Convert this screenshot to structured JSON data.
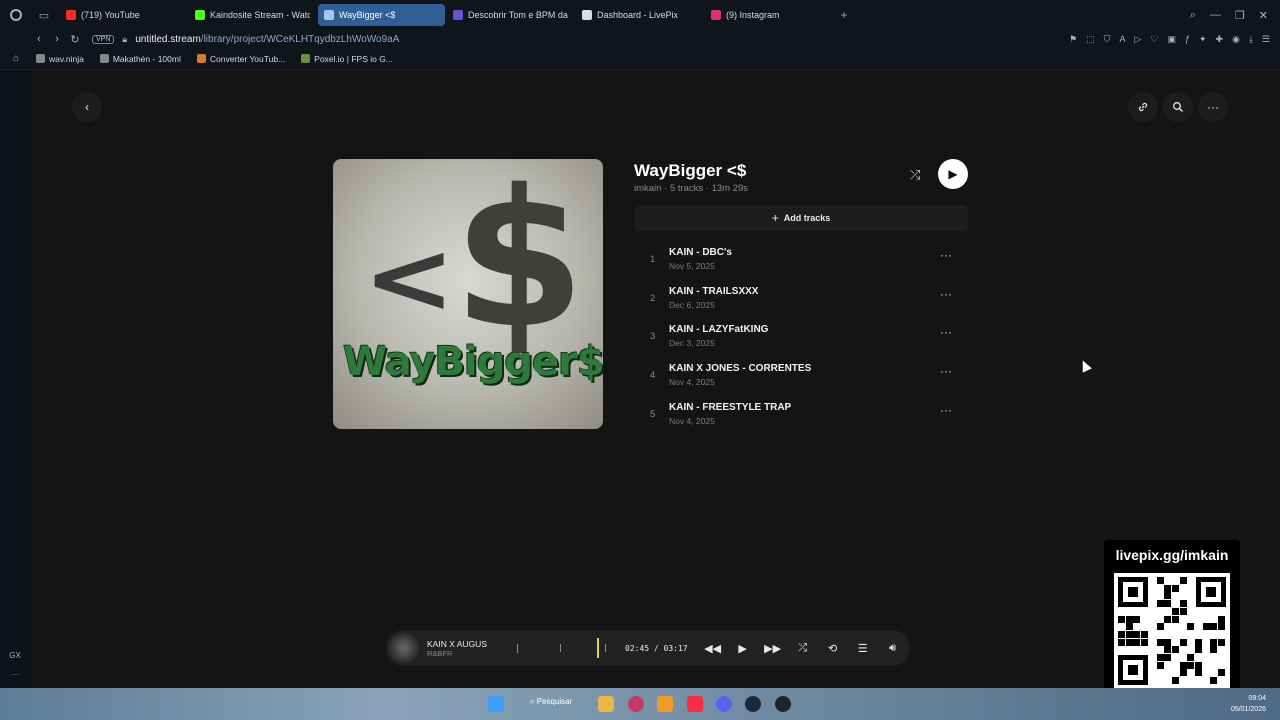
{
  "browser": {
    "tabs": [
      {
        "label": "(719) YouTube",
        "color": "#ff2b2b"
      },
      {
        "label": "Kaindosite Stream - Watc",
        "color": "#53fc18"
      },
      {
        "label": "WayBigger <$",
        "color": "#a8c4f0",
        "active": true
      },
      {
        "label": "Descobrir Tom e BPM da",
        "color": "#6b52c9"
      },
      {
        "label": "Dashboard - LivePix",
        "color": "#d8dde6"
      },
      {
        "label": "(9) Instagram",
        "color": "#e1306c"
      }
    ],
    "new_tab": "+",
    "vpn_label": "VPN",
    "url_host": "untitled.stream",
    "url_path": "/library/project/WCeKLHTqydbzLhWoWo9aA",
    "bookmarks": [
      {
        "label": "wav.ninja",
        "color": "#888888"
      },
      {
        "label": "Makathén - 100ml",
        "color": "#888888"
      },
      {
        "label": "Converter YouTub...",
        "color": "#d77a2a"
      },
      {
        "label": "Poxel.io | FPS io G...",
        "color": "#6b8f3a"
      }
    ],
    "sidebar_bottom": {
      "gx": "GX",
      "more": "···"
    }
  },
  "header": {
    "back_icon": "chevron-left-icon",
    "link_icon": "link-icon",
    "search_icon": "search-icon",
    "more_icon": "more-horizontal-icon"
  },
  "cover": {
    "lt": "<",
    "dollar": "$",
    "text": "WayBigger$"
  },
  "project": {
    "title": "WayBigger <$",
    "meta": "imkain · 5 tracks · 13m 29s",
    "add_tracks_label": "Add tracks"
  },
  "tracks": [
    {
      "num": "1",
      "name": "KAIN - DBC's",
      "date": "Nov 5, 2025"
    },
    {
      "num": "2",
      "name": "KAIN - TRAILSXXX",
      "date": "Dec 6, 2025"
    },
    {
      "num": "3",
      "name": "KAIN - LAZYFatKING",
      "date": "Dec 3, 2025"
    },
    {
      "num": "4",
      "name": "KAIN X JONES - CORRENTES",
      "date": "Nov 4, 2025"
    },
    {
      "num": "5",
      "name": "KAIN - FREESTYLE TRAP",
      "date": "Nov 4, 2025"
    }
  ],
  "player": {
    "title": "KAIN X AUGUS",
    "genre": "R&BFR",
    "time": "02:45 / 03:17",
    "progress": 0.85
  },
  "overlay": {
    "qr_caption": "livepix.gg/imkain"
  },
  "taskbar": {
    "search_label": "Pesquisar",
    "time": "09:04",
    "date": "05/01/2026"
  }
}
